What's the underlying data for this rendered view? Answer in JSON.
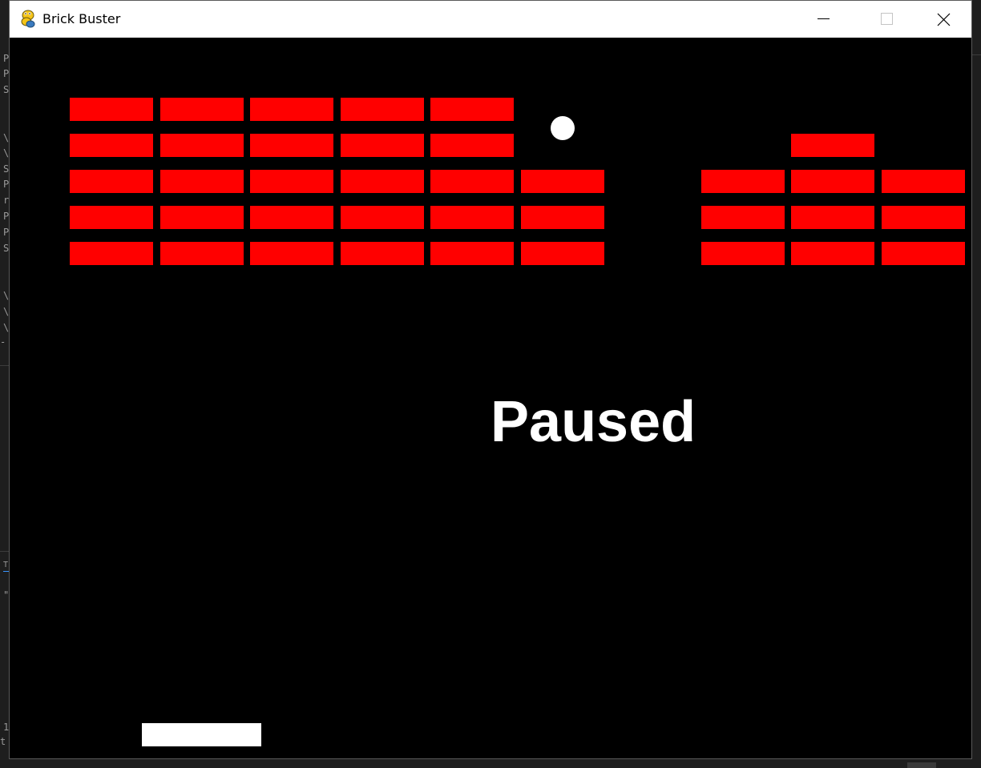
{
  "window": {
    "title": "Brick Buster",
    "controls": {
      "minimize": "minimize",
      "maximize": "maximize",
      "close": "close"
    }
  },
  "background_editor": {
    "lines": [
      {
        "text": "P"
      },
      {
        "text": "P"
      },
      {
        "text": "S"
      },
      {
        "text": "\\"
      },
      {
        "text": "\\"
      },
      {
        "text": "S"
      },
      {
        "text": "P"
      },
      {
        "text": "r"
      },
      {
        "text": "P"
      },
      {
        "text": "P"
      },
      {
        "text": "S"
      },
      {
        "text": "\\"
      },
      {
        "text": "\\"
      },
      {
        "text": "\\"
      },
      {
        "text": "-"
      },
      {
        "text": "TI"
      },
      {
        "text": "\""
      },
      {
        "text": "1"
      },
      {
        "text": "t"
      }
    ]
  },
  "game": {
    "status_text": "Paused",
    "colors": {
      "background": "#000000",
      "brick": "#ff0000",
      "ball": "#ffffff",
      "paddle": "#ffffff",
      "text": "#ffffff"
    },
    "brick_grid": {
      "rows": 5,
      "columns": 10,
      "present": [
        [
          1,
          1,
          1,
          1,
          1,
          0,
          0,
          0,
          0,
          0
        ],
        [
          1,
          1,
          1,
          1,
          1,
          0,
          0,
          0,
          1,
          0
        ],
        [
          1,
          1,
          1,
          1,
          1,
          1,
          0,
          1,
          1,
          1
        ],
        [
          1,
          1,
          1,
          1,
          1,
          1,
          0,
          1,
          1,
          1
        ],
        [
          1,
          1,
          1,
          1,
          1,
          1,
          0,
          1,
          1,
          1
        ]
      ]
    }
  }
}
